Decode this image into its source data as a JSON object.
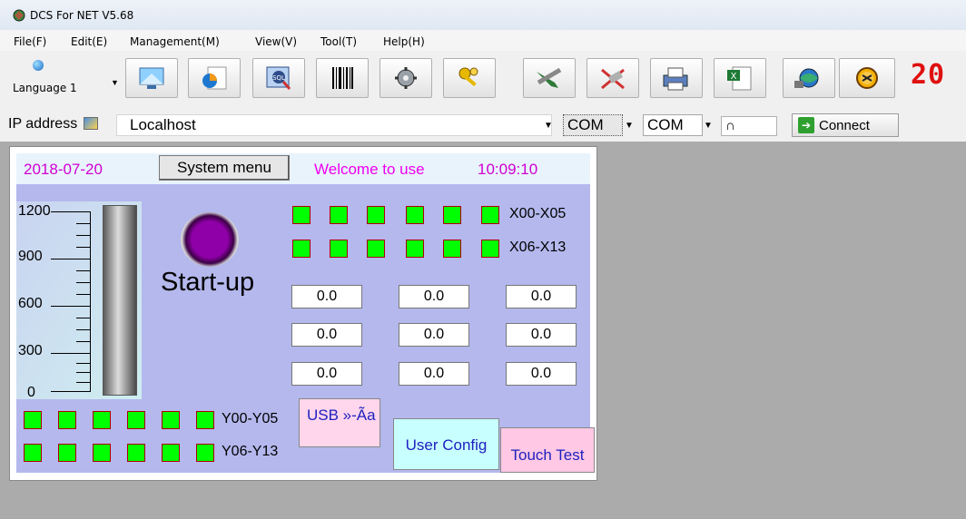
{
  "window": {
    "title": "DCS For NET V5.68"
  },
  "menu": [
    "File(F)",
    "Edit(E)",
    "Management(M)",
    "View(V)",
    "Tool(T)",
    "Help(H)"
  ],
  "toolbar": {
    "language_label": "Language 1",
    "buttons": [
      "screen-icon",
      "chart-icon",
      "sql-icon",
      "barcode-icon",
      "gear-icon",
      "key-icon",
      "tools-icon",
      "delete-icon",
      "printer-icon",
      "excel-icon",
      "network-icon",
      "exit-icon"
    ],
    "counter": "20"
  },
  "address": {
    "label": "IP address",
    "value": "Localhost",
    "com1": "COM",
    "com2": "COM",
    "port_value": "∩",
    "connect_label": "Connect"
  },
  "screen": {
    "date": "2018-07-20",
    "system_menu_label": "System menu",
    "welcome": "Welcome to use",
    "time": "10:09:10",
    "gauge": {
      "ticks": [
        "1200",
        "900",
        "600",
        "300",
        "0"
      ],
      "level": 0
    },
    "startup_label": "Start-up",
    "x_rows": [
      "X00-X05",
      "X06-X13"
    ],
    "y_rows": [
      "Y00-Y05",
      "Y06-Y13"
    ],
    "values": [
      [
        "0.0",
        "0.0",
        "0.0"
      ],
      [
        "0.0",
        "0.0",
        "0.0"
      ],
      [
        "0.0",
        "0.0",
        "0.0"
      ]
    ],
    "usb_label": "USB »-Ãa",
    "user_config_label": "User Config",
    "touch_test_label": "Touch Test"
  },
  "colors": {
    "led_on": "#00ff00",
    "screen_bg": "#b4b8ed",
    "date_color": "#d000d0"
  }
}
